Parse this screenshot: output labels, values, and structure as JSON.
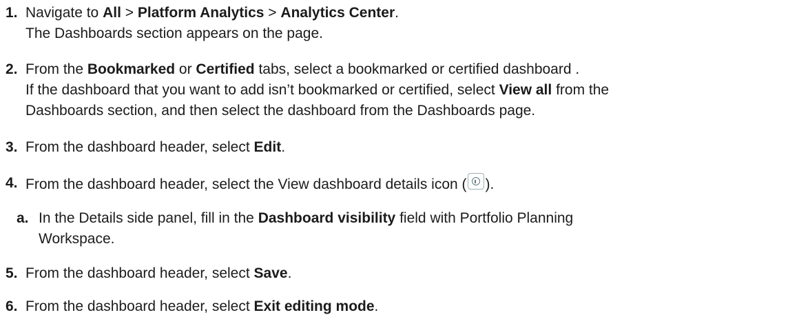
{
  "steps": [
    {
      "number": "1.",
      "line1": [
        "Navigate to ",
        "All",
        " > ",
        "Platform Analytics",
        " > ",
        "Analytics Center",
        "."
      ],
      "line2": "The Dashboards section appears on the page."
    },
    {
      "number": "2.",
      "line1": [
        "From the ",
        "Bookmarked",
        " or ",
        "Certified",
        " tabs, select a bookmarked or certified dashboard ."
      ],
      "line2": [
        "If the dashboard that you want to add isn’t bookmarked or certified, select ",
        "View all",
        " from the"
      ],
      "line3": "Dashboards section, and then select the dashboard from the Dashboards page."
    },
    {
      "number": "3.",
      "line1": [
        "From the dashboard header, select ",
        "Edit",
        "."
      ]
    },
    {
      "number": "4.",
      "line1": [
        "From the dashboard header, select the View dashboard details icon (",
        ")."
      ],
      "icon": "info-icon",
      "sub": {
        "number": "a.",
        "line1": [
          "In the Details side panel, fill in the ",
          "Dashboard visibility",
          " field with Portfolio Planning"
        ],
        "line2": "Workspace."
      }
    },
    {
      "number": "5.",
      "line1": [
        "From the dashboard header, select ",
        "Save",
        "."
      ]
    },
    {
      "number": "6.",
      "line1": [
        "From the dashboard header, select ",
        "Exit editing mode",
        "."
      ]
    }
  ]
}
